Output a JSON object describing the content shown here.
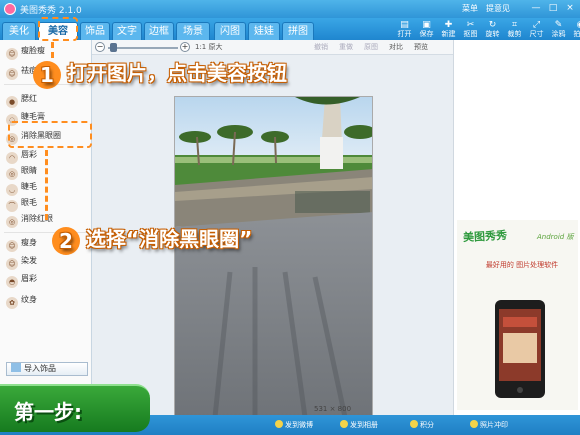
{
  "titlebar": {
    "title": "美图秀秀 2.1.0",
    "menu": [
      "菜单",
      "提意见"
    ],
    "win_buttons": [
      "—",
      "□",
      "×"
    ]
  },
  "tabs": [
    "美化",
    "美容",
    "饰品",
    "文字",
    "边框",
    "场景",
    "闪图",
    "娃娃",
    "拼图"
  ],
  "active_tab": "美容",
  "toolbar": [
    "打开",
    "保存",
    "新建",
    "抠图",
    "旋转",
    "裁剪",
    "尺寸",
    "涂鸦",
    "拍照"
  ],
  "sidebar": {
    "items": [
      "瘦脸瘦",
      "祛痘",
      "腮红",
      "睫毛膏",
      "消除黑眼圈",
      "唇彩",
      "眼睛",
      "睫毛",
      "眼毛",
      "消除红眼",
      "瘦身",
      "染发",
      "眉彩",
      "纹身"
    ],
    "import_button": "导入饰品"
  },
  "editor": {
    "zoom_label": "1:1 原大",
    "actions": [
      "撤销",
      "重做",
      "原图",
      "对比",
      "预览"
    ],
    "size_text": "531 × 800"
  },
  "right_panel": {
    "ad_title": "美图秀秀",
    "ad_android": "Android 版",
    "ad_text": "最好用的 图片处理软件"
  },
  "status": [
    "发到微博",
    "发到相册",
    "积分",
    "照片冲印"
  ],
  "annotations": {
    "step1_num": "1",
    "step1_text": "打开图片，点击美容按钮",
    "step2_num": "2",
    "step2_text": "选择“消除黑眼圈”",
    "step_badge": "第一步:"
  }
}
